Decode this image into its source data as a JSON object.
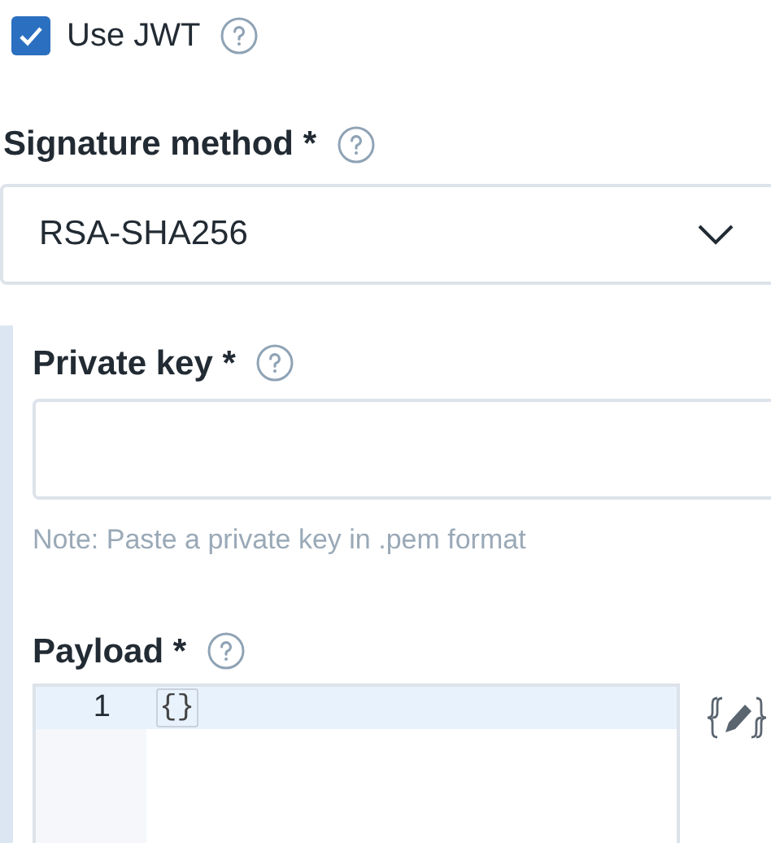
{
  "use_jwt": {
    "label": "Use JWT",
    "checked": true
  },
  "signature_method": {
    "label": "Signature method *",
    "value": "RSA-SHA256"
  },
  "private_key": {
    "label": "Private key *",
    "note": "Note: Paste a private key in .pem format"
  },
  "payload": {
    "label": "Payload *",
    "lines": [
      {
        "number": "1",
        "text": "{}"
      }
    ]
  }
}
